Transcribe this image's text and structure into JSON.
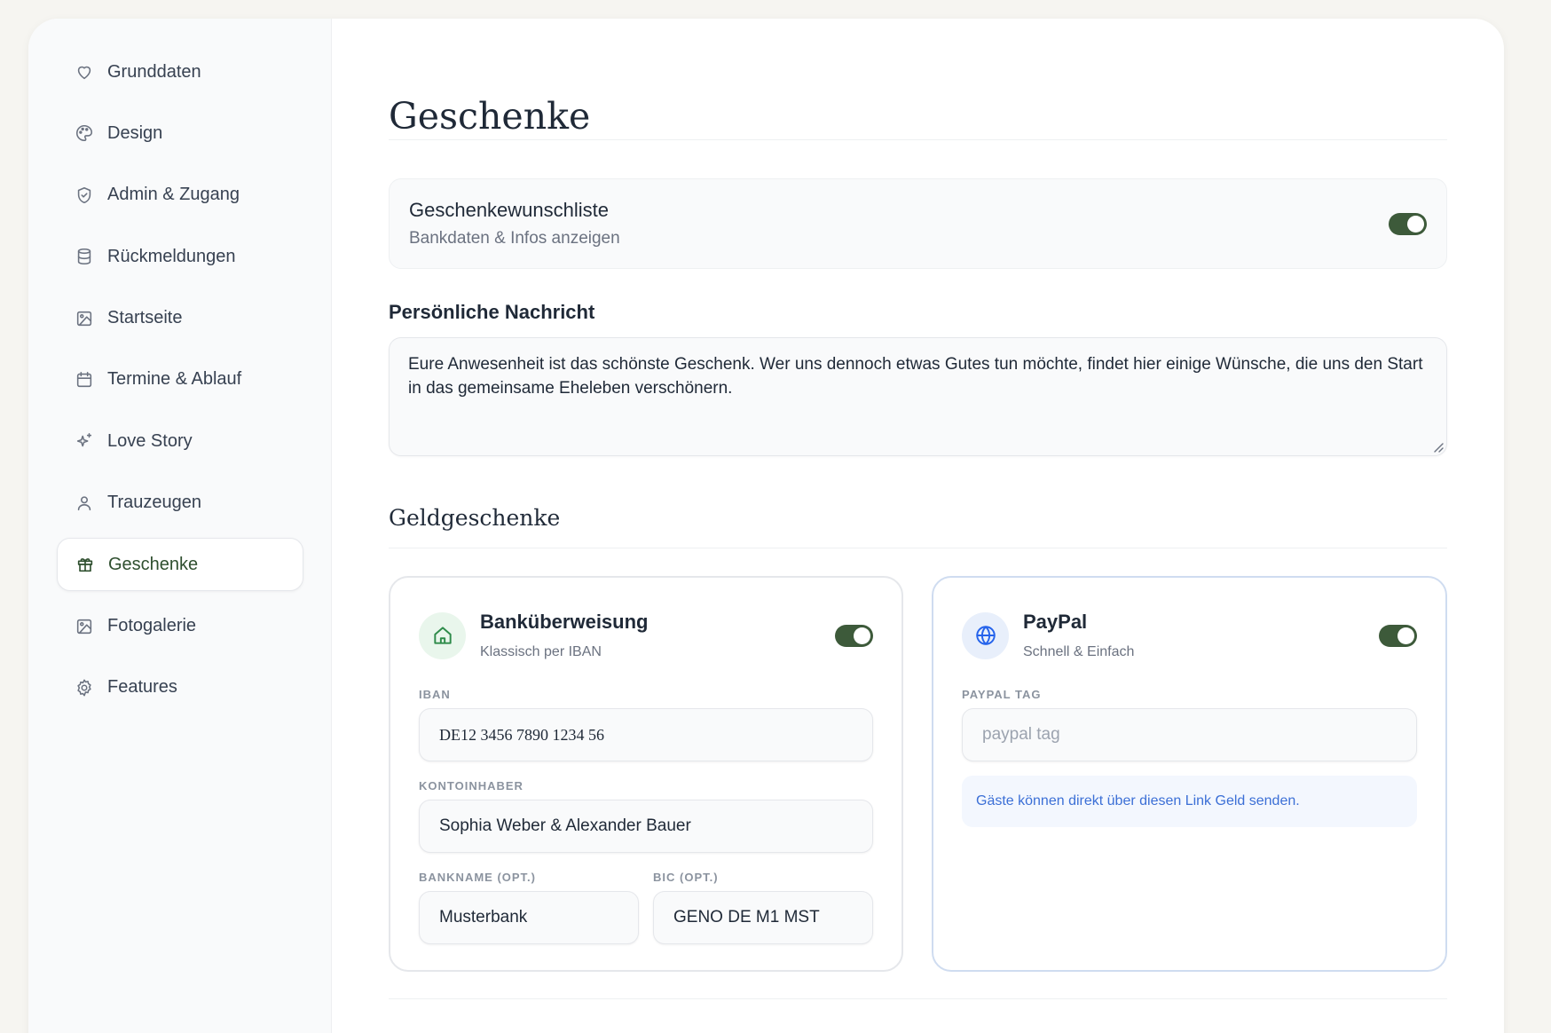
{
  "sidebar": {
    "items": [
      {
        "label": "Grunddaten",
        "icon": "heart-icon"
      },
      {
        "label": "Design",
        "icon": "palette-icon"
      },
      {
        "label": "Admin & Zugang",
        "icon": "shield-check-icon"
      },
      {
        "label": "Rückmeldungen",
        "icon": "database-icon"
      },
      {
        "label": "Startseite",
        "icon": "image-icon"
      },
      {
        "label": "Termine & Ablauf",
        "icon": "calendar-icon"
      },
      {
        "label": "Love Story",
        "icon": "sparkles-icon"
      },
      {
        "label": "Trauzeugen",
        "icon": "user-icon"
      },
      {
        "label": "Geschenke",
        "icon": "gift-icon",
        "active": true
      },
      {
        "label": "Fotogalerie",
        "icon": "image-icon"
      },
      {
        "label": "Features",
        "icon": "gear-icon"
      }
    ]
  },
  "main": {
    "title": "Geschenke",
    "wishlist": {
      "title": "Geschenkewunschliste",
      "subtitle": "Bankdaten & Infos anzeigen",
      "enabled": true
    },
    "message": {
      "label": "Persönliche Nachricht",
      "value": "Eure Anwesenheit ist das schönste Geschenk. Wer uns dennoch etwas Gutes tun möchte, findet hier einige Wünsche, die uns den Start in das gemeinsame Eheleben verschönern."
    },
    "money_gifts": {
      "heading": "Geldgeschenke",
      "bank": {
        "title": "Banküberweisung",
        "subtitle": "Klassisch per IBAN",
        "enabled": true,
        "icon": "home-icon",
        "iban_label": "IBAN",
        "iban_value": "DE12 3456 7890 1234 56",
        "holder_label": "Kontoinhaber",
        "holder_value": "Sophia Weber & Alexander Bauer",
        "bankname_label": "Bankname (opt.)",
        "bankname_value": "Musterbank",
        "bic_label": "BIC (opt.)",
        "bic_value": "GENO DE M1 MST"
      },
      "paypal": {
        "title": "PayPal",
        "subtitle": "Schnell & Einfach",
        "enabled": true,
        "icon": "globe-icon",
        "tag_label": "PayPal Tag",
        "tag_placeholder": "paypal tag",
        "info": "Gäste können direkt über diesen Link Geld senden."
      }
    }
  },
  "colors": {
    "accent": "#3d5a3a",
    "active_text": "#2f4f2f",
    "link_blue": "#3b6fd6",
    "bank_icon_bg": "#e9f6ec",
    "bank_icon": "#2e8b4a",
    "paypal_icon_bg": "#e8effb",
    "paypal_icon": "#2563eb"
  }
}
